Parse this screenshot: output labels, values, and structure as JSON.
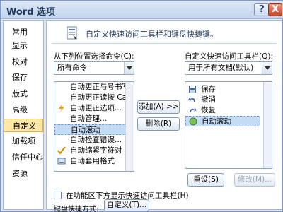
{
  "window": {
    "title": "Word 选项"
  },
  "titlebar": {
    "help_glyph": "?",
    "close_glyph": "X"
  },
  "sidebar": {
    "items": [
      {
        "label": "常用",
        "active": false
      },
      {
        "label": "显示",
        "active": false
      },
      {
        "label": "校对",
        "active": false
      },
      {
        "label": "保存",
        "active": false
      },
      {
        "label": "版式",
        "active": false
      },
      {
        "label": "高级",
        "active": false
      },
      {
        "label": "自定义",
        "active": true
      },
      {
        "label": "加载项",
        "active": false
      },
      {
        "label": "信任中心",
        "active": false
      },
      {
        "label": "资源",
        "active": false
      }
    ]
  },
  "main": {
    "heading": "自定义快速访问工具栏和键盘快捷键。",
    "choose_from_label": "从下列位置选择命令(C):",
    "choose_from_value": "所有命令",
    "customize_label": "自定义快速访问工具栏(Q):",
    "customize_value": "用于所有文档(默认)",
    "commands": [
      {
        "label": "自动更正与号书写",
        "icon": "autocorrect-icon"
      },
      {
        "label": "自动更正读按 Ca",
        "icon": "autocorrect-icon"
      },
      {
        "label": "自动更正选项...",
        "icon": "lightning-icon"
      },
      {
        "label": "自动管理...",
        "icon": "none"
      },
      {
        "label": "自动滚动",
        "icon": "none",
        "selected": true
      },
      {
        "label": "自动检查错误...",
        "icon": "none"
      },
      {
        "label": "自动缩紧字符对",
        "icon": "check-icon"
      },
      {
        "label": "自动套用格式",
        "icon": "format-icon"
      }
    ],
    "toolbar_items": [
      {
        "label": "保存",
        "icon": "save-icon"
      },
      {
        "label": "撤消",
        "icon": "undo-icon"
      },
      {
        "label": "恢复",
        "icon": "redo-icon"
      },
      {
        "label": "自动滚动",
        "icon": "scroll-icon",
        "selected": true
      }
    ],
    "add_button": "添加(A) >>",
    "remove_button": "删除(R)",
    "reset_button": "重设(S)",
    "modify_button": "修改(M)...",
    "show_below_ribbon": "在功能区下方显示快速访问工具栏(H)",
    "keyboard_label": "键盘快捷方式:",
    "customize_button": "自定义(T)..."
  },
  "colors": {
    "accent": "#ffe8a6",
    "selection": "#c5dcf7",
    "border": "#8ea6c8"
  }
}
